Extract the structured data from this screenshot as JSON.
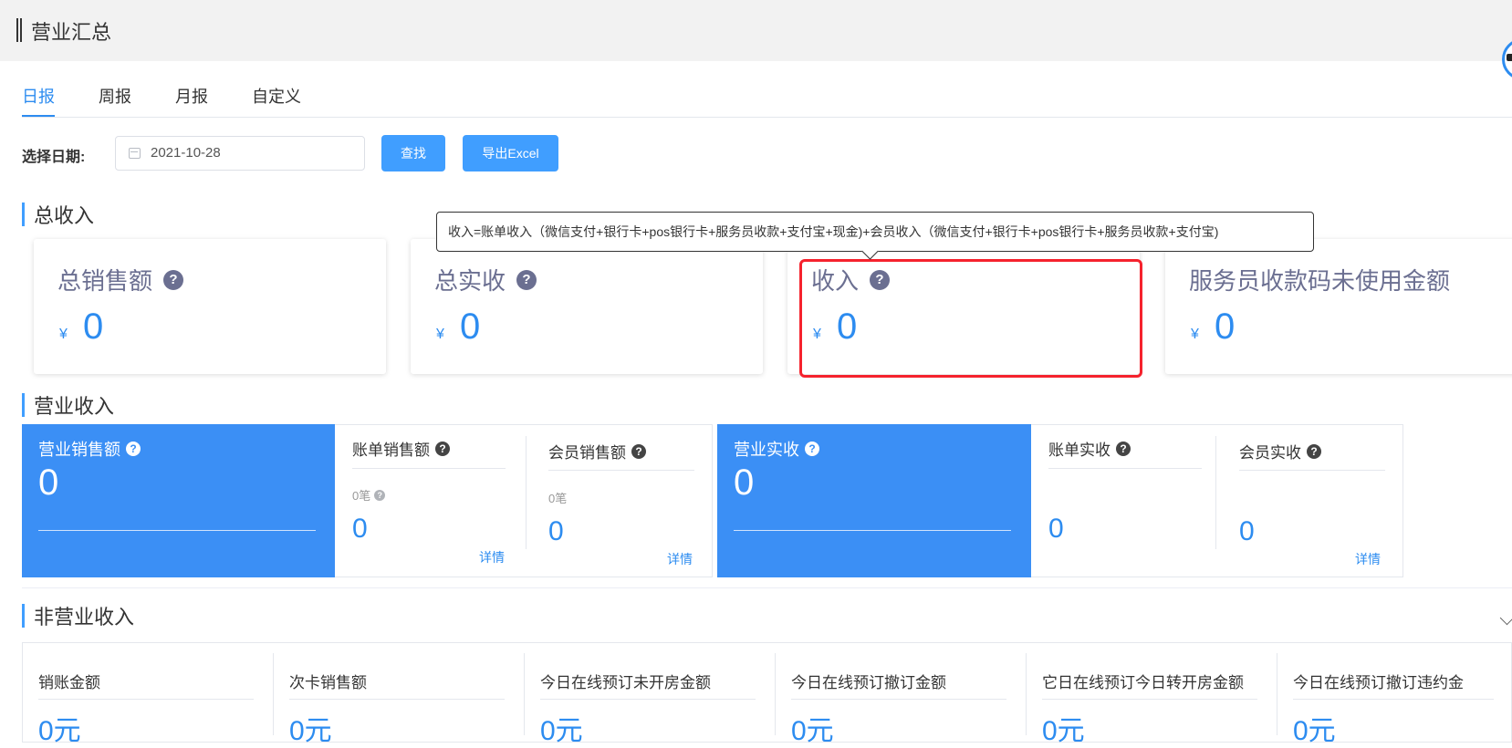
{
  "header": {
    "title": "营业汇总"
  },
  "tabs": [
    "日报",
    "周报",
    "月报",
    "自定义"
  ],
  "filter": {
    "label": "选择日期:",
    "date": "2021-10-28",
    "search_label": "查找",
    "export_label": "导出Excel"
  },
  "total_income": {
    "title": "总收入",
    "cards": [
      {
        "label": "总销售额",
        "help": "?",
        "currency": "¥",
        "value": "0"
      },
      {
        "label": "总实收",
        "help": "?",
        "currency": "¥",
        "value": "0"
      },
      {
        "label": "收入",
        "help": "?",
        "currency": "¥",
        "value": "0"
      },
      {
        "label": "服务员收款码未使用金额",
        "currency": "¥",
        "value": "0"
      }
    ],
    "tooltip": "收入=账单收入（微信支付+银行卡+pos银行卡+服务员收款+支付宝+现金)+会员收入（微信支付+银行卡+pos银行卡+服务员收款+支付宝)"
  },
  "business_income": {
    "title": "营业收入",
    "sales": {
      "label": "营业销售额",
      "value": "0",
      "bill": {
        "label": "账单销售额",
        "count": "0笔",
        "value": "0",
        "link": "详情"
      },
      "member": {
        "label": "会员销售额",
        "count": "0笔",
        "value": "0",
        "link": "详情"
      }
    },
    "received": {
      "label": "营业实收",
      "value": "0",
      "bill": {
        "label": "账单实收",
        "value": "0"
      },
      "member": {
        "label": "会员实收",
        "value": "0",
        "link": "详情"
      }
    }
  },
  "non_business_income": {
    "title": "非营业收入",
    "items": [
      {
        "label": "销账金额",
        "value": "0元"
      },
      {
        "label": "次卡销售额",
        "value": "0元"
      },
      {
        "label": "今日在线预订未开房金额",
        "value": "0元"
      },
      {
        "label": "今日在线预订撤订金额",
        "value": "0元"
      },
      {
        "label": "它日在线预订今日转开房金额",
        "value": "0元"
      },
      {
        "label": "今日在线预订撤订违约金",
        "value": "0元"
      }
    ]
  },
  "colors": {
    "accent": "#409eff",
    "highlight": "#f5222d",
    "block": "#3b8ff5"
  }
}
